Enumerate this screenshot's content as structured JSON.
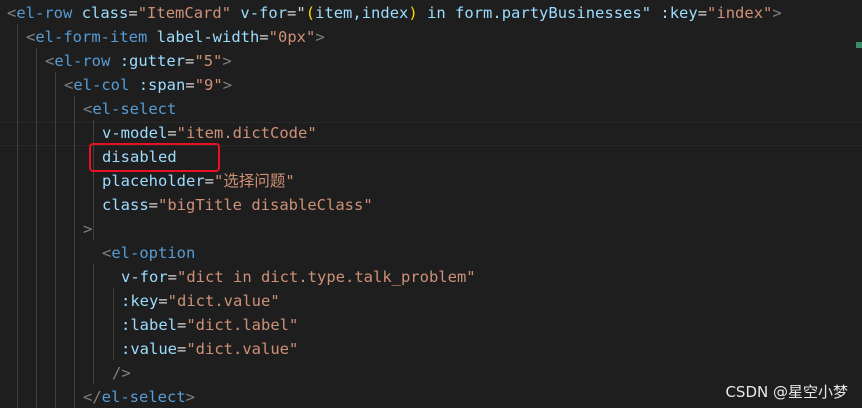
{
  "code": {
    "line1": {
      "open": "<",
      "tag": "el-row",
      "sp1": " ",
      "attr1": "class",
      "eq1": "=",
      "val1": "\"ItemCard\"",
      "sp2": " ",
      "attr2": "v-for",
      "eq2": "=\"",
      "paren_open": "(",
      "loop_vars": "item,index",
      "paren_close": ")",
      "loop_rest": " in form.partyBusinesses\"",
      "sp3": " ",
      "attr3": ":key",
      "eq3": "=",
      "val3": "\"index\"",
      "close": ">"
    },
    "line2": {
      "open": "<",
      "tag": "el-form-item",
      "sp1": " ",
      "attr1": "label-width",
      "eq1": "=",
      "val1": "\"0px\"",
      "close": ">"
    },
    "line3": {
      "open": "<",
      "tag": "el-row",
      "sp1": " ",
      "attr1": ":gutter",
      "eq1": "=",
      "val1": "\"5\"",
      "close": ">"
    },
    "line4": {
      "open": "<",
      "tag": "el-col",
      "sp1": " ",
      "attr1": ":span",
      "eq1": "=",
      "val1": "\"9\"",
      "close": ">"
    },
    "line5": {
      "open": "<",
      "tag": "el-select"
    },
    "line6": {
      "attr": "v-model",
      "eq": "=",
      "val": "\"item.dictCode\""
    },
    "line7": {
      "attr": "disabled"
    },
    "line8": {
      "attr": "placeholder",
      "eq": "=",
      "val": "\"选择问题\""
    },
    "line9": {
      "attr": "class",
      "eq": "=",
      "val": "\"bigTitle disableClass\""
    },
    "line10": {
      "close": ">"
    },
    "line11": {
      "open": "<",
      "tag": "el-option"
    },
    "line12": {
      "attr": "v-for",
      "eq": "=",
      "val": "\"dict in dict.type.talk_problem\""
    },
    "line13": {
      "attr": ":key",
      "eq": "=",
      "val": "\"dict.value\""
    },
    "line14": {
      "attr": ":label",
      "eq": "=",
      "val": "\"dict.label\""
    },
    "line15": {
      "attr": ":value",
      "eq": "=",
      "val": "\"dict.value\""
    },
    "line16": {
      "close": "/>"
    },
    "line17": {
      "open": "</",
      "tag": "el-select",
      "close": ">"
    }
  },
  "watermark": "CSDN @星空小梦",
  "colors": {
    "background": "#1e1e1e",
    "tag": "#569cd6",
    "attribute": "#9cdcfe",
    "string": "#ce9178",
    "punctuation": "#808080",
    "highlight_border": "#e81123"
  }
}
